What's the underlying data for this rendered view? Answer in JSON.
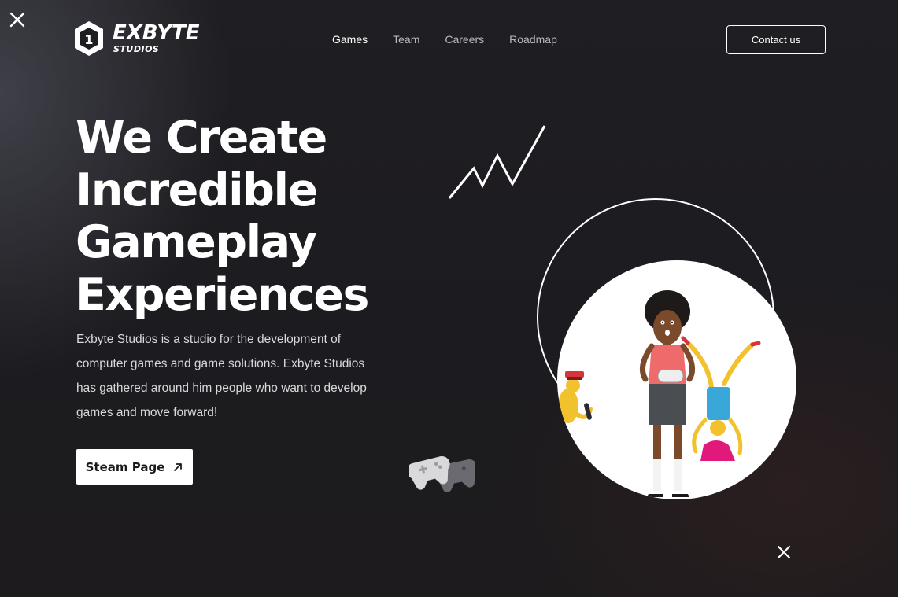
{
  "brand": {
    "name": "EXBYTE",
    "sub": "STUDIOS",
    "mark": "1"
  },
  "nav": {
    "items": [
      {
        "label": "Games",
        "active": true
      },
      {
        "label": "Team",
        "active": false
      },
      {
        "label": "Careers",
        "active": false
      },
      {
        "label": "Roadmap",
        "active": false
      }
    ],
    "contact_label": "Contact us"
  },
  "hero": {
    "title_lines": [
      "We Create",
      "Incredible",
      "Gameplay",
      "Experiences"
    ],
    "description": "Exbyte Studios is a studio for the development of computer games and game solutions. Exbyte Studios has gathered around him people who want to develop games and move forward!",
    "cta_label": "Steam Page"
  },
  "icons": {
    "cta": "arrow-up-right-icon",
    "close_top_left": "cross-icon",
    "close_bottom_right": "cross-icon"
  },
  "colors": {
    "background": "#1d1c20",
    "accent": "#ffffff",
    "nav_inactive": "#b9b9bd"
  }
}
